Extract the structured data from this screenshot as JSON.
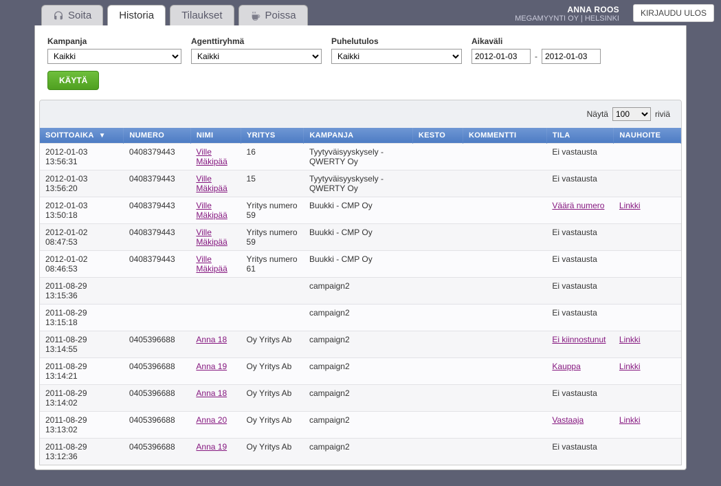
{
  "header": {
    "user_name": "ANNA ROOS",
    "company": "MEGAMYYNTI OY",
    "location": "HELSINKI",
    "logout_label": "KIRJAUDU ULOS"
  },
  "tabs": {
    "soita": "Soita",
    "historia": "Historia",
    "tilaukset": "Tilaukset",
    "poissa": "Poissa"
  },
  "filters": {
    "kampanja": {
      "label": "Kampanja",
      "value": "Kaikki"
    },
    "agenttiryhma": {
      "label": "Agenttiryhmä",
      "value": "Kaikki"
    },
    "puhelutulos": {
      "label": "Puhelutulos",
      "value": "Kaikki"
    },
    "aikavali": {
      "label": "Aikaväli",
      "from": "2012-01-03",
      "sep": "-",
      "to": "2012-01-03"
    },
    "apply_label": "KÄYTÄ"
  },
  "pager": {
    "nayta": "Näytä",
    "rivia": "riviä",
    "value": "100"
  },
  "columns": {
    "soittoaika": "SOITTOAIKA",
    "numero": "NUMERO",
    "nimi": "NIMI",
    "yritys": "YRITYS",
    "kampanja": "KAMPANJA",
    "kesto": "KESTO",
    "kommentti": "KOMMENTTI",
    "tila": "TILA",
    "nauhoite": "NAUHOITE"
  },
  "rows": [
    {
      "soittoaika": "2012-01-03 13:56:31",
      "numero": "0408379443",
      "nimi": "Ville Mäkipää",
      "nimi_link": true,
      "yritys": "16",
      "kampanja": "Tyytyväisyyskysely - QWERTY Oy",
      "kesto": "",
      "kommentti": "",
      "tila": "Ei vastausta",
      "tila_link": false,
      "nauhoite": ""
    },
    {
      "soittoaika": "2012-01-03 13:56:20",
      "numero": "0408379443",
      "nimi": "Ville Mäkipää",
      "nimi_link": true,
      "yritys": "15",
      "kampanja": "Tyytyväisyyskysely - QWERTY Oy",
      "kesto": "",
      "kommentti": "",
      "tila": "Ei vastausta",
      "tila_link": false,
      "nauhoite": ""
    },
    {
      "soittoaika": "2012-01-03 13:50:18",
      "numero": "0408379443",
      "nimi": "Ville Mäkipää",
      "nimi_link": true,
      "yritys": "Yritys numero 59",
      "kampanja": "Buukki - CMP Oy",
      "kesto": "",
      "kommentti": "",
      "tila": "Väärä numero",
      "tila_link": true,
      "nauhoite": "Linkki"
    },
    {
      "soittoaika": "2012-01-02 08:47:53",
      "numero": "0408379443",
      "nimi": "Ville Mäkipää",
      "nimi_link": true,
      "yritys": "Yritys numero 59",
      "kampanja": "Buukki - CMP Oy",
      "kesto": "",
      "kommentti": "",
      "tila": "Ei vastausta",
      "tila_link": false,
      "nauhoite": ""
    },
    {
      "soittoaika": "2012-01-02 08:46:53",
      "numero": "0408379443",
      "nimi": "Ville Mäkipää",
      "nimi_link": true,
      "yritys": "Yritys numero 61",
      "kampanja": "Buukki - CMP Oy",
      "kesto": "",
      "kommentti": "",
      "tila": "Ei vastausta",
      "tila_link": false,
      "nauhoite": ""
    },
    {
      "soittoaika": "2011-08-29 13:15:36",
      "numero": "",
      "nimi": "",
      "nimi_link": false,
      "yritys": "",
      "kampanja": "campaign2",
      "kesto": "",
      "kommentti": "",
      "tila": "Ei vastausta",
      "tila_link": false,
      "nauhoite": ""
    },
    {
      "soittoaika": "2011-08-29 13:15:18",
      "numero": "",
      "nimi": "",
      "nimi_link": false,
      "yritys": "",
      "kampanja": "campaign2",
      "kesto": "",
      "kommentti": "",
      "tila": "Ei vastausta",
      "tila_link": false,
      "nauhoite": ""
    },
    {
      "soittoaika": "2011-08-29 13:14:55",
      "numero": "0405396688",
      "nimi": "Anna 18",
      "nimi_link": true,
      "yritys": "Oy Yritys Ab",
      "kampanja": "campaign2",
      "kesto": "",
      "kommentti": "",
      "tila": "Ei kiinnostunut",
      "tila_link": true,
      "nauhoite": "Linkki"
    },
    {
      "soittoaika": "2011-08-29 13:14:21",
      "numero": "0405396688",
      "nimi": "Anna 19",
      "nimi_link": true,
      "yritys": "Oy Yritys Ab",
      "kampanja": "campaign2",
      "kesto": "",
      "kommentti": "",
      "tila": "Kauppa",
      "tila_link": true,
      "nauhoite": "Linkki"
    },
    {
      "soittoaika": "2011-08-29 13:14:02",
      "numero": "0405396688",
      "nimi": "Anna 18",
      "nimi_link": true,
      "yritys": "Oy Yritys Ab",
      "kampanja": "campaign2",
      "kesto": "",
      "kommentti": "",
      "tila": "Ei vastausta",
      "tila_link": false,
      "nauhoite": ""
    },
    {
      "soittoaika": "2011-08-29 13:13:02",
      "numero": "0405396688",
      "nimi": "Anna 20",
      "nimi_link": true,
      "yritys": "Oy Yritys Ab",
      "kampanja": "campaign2",
      "kesto": "",
      "kommentti": "",
      "tila": "Vastaaja",
      "tila_link": true,
      "nauhoite": "Linkki"
    },
    {
      "soittoaika": "2011-08-29 13:12:36",
      "numero": "0405396688",
      "nimi": "Anna 19",
      "nimi_link": true,
      "yritys": "Oy Yritys Ab",
      "kampanja": "campaign2",
      "kesto": "",
      "kommentti": "",
      "tila": "Ei vastausta",
      "tila_link": false,
      "nauhoite": ""
    }
  ]
}
